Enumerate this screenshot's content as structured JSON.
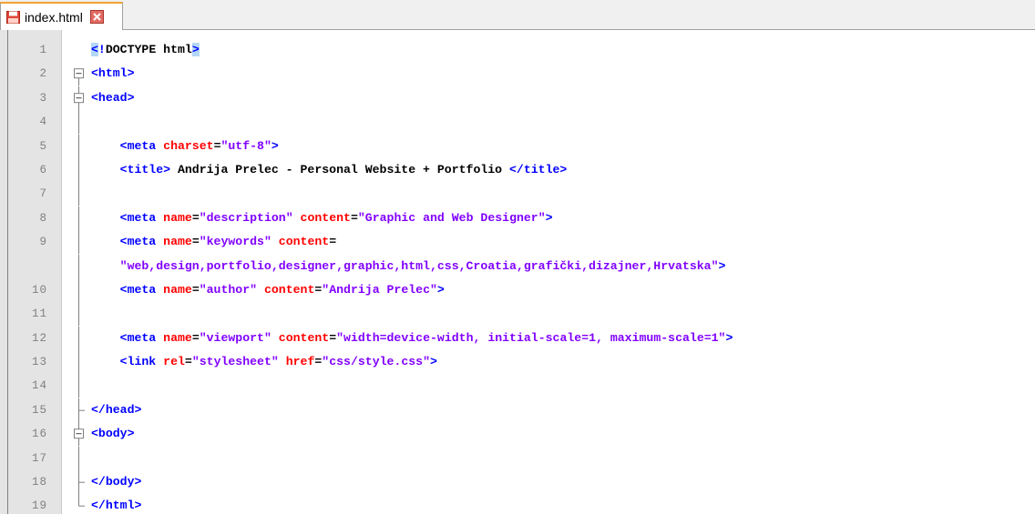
{
  "tab": {
    "filename": "index.html",
    "icon": "save-disk-icon",
    "close_icon": "close-icon"
  },
  "colors": {
    "tag": "#0000ff",
    "attribute": "#ff0000",
    "string": "#8000ff",
    "text": "#000000",
    "line_number": "#808080",
    "gutter_bg": "#e4e4e4",
    "brace_highlight": "#b3d7f7",
    "tab_accent": "#f3a332"
  },
  "editor": {
    "lines": [
      {
        "n": "1",
        "fold": "none"
      },
      {
        "n": "2",
        "fold": "open"
      },
      {
        "n": "3",
        "fold": "open"
      },
      {
        "n": "4",
        "fold": "line"
      },
      {
        "n": "5",
        "fold": "line"
      },
      {
        "n": "6",
        "fold": "line"
      },
      {
        "n": "7",
        "fold": "line"
      },
      {
        "n": "8",
        "fold": "line"
      },
      {
        "n": "9",
        "fold": "line"
      },
      {
        "n": "",
        "fold": "line"
      },
      {
        "n": "10",
        "fold": "line"
      },
      {
        "n": "11",
        "fold": "line"
      },
      {
        "n": "12",
        "fold": "line"
      },
      {
        "n": "13",
        "fold": "line"
      },
      {
        "n": "14",
        "fold": "line"
      },
      {
        "n": "15",
        "fold": "end"
      },
      {
        "n": "16",
        "fold": "open"
      },
      {
        "n": "17",
        "fold": "line"
      },
      {
        "n": "18",
        "fold": "end"
      },
      {
        "n": "19",
        "fold": "last"
      }
    ],
    "code": [
      "<!DOCTYPE html>",
      "<html>",
      "<head>",
      "",
      "    <meta charset=\"utf-8\">",
      "    <title> Andrija Prelec - Personal Website + Portfolio </title>",
      "",
      "    <meta name=\"description\" content=\"Graphic and Web Designer\">",
      "    <meta name=\"keywords\" content=",
      "    \"web,design,portfolio,designer,graphic,html,css,Croatia,grafički,dizajner,Hrvatska\">",
      "    <meta name=\"author\" content=\"Andrija Prelec\">",
      "",
      "    <meta name=\"viewport\" content=\"width=device-width, initial-scale=1, maximum-scale=1\">",
      "    <link rel=\"stylesheet\" href=\"css/style.css\">",
      "",
      "</head>",
      "<body>",
      "",
      "</body>",
      "</html>"
    ]
  }
}
